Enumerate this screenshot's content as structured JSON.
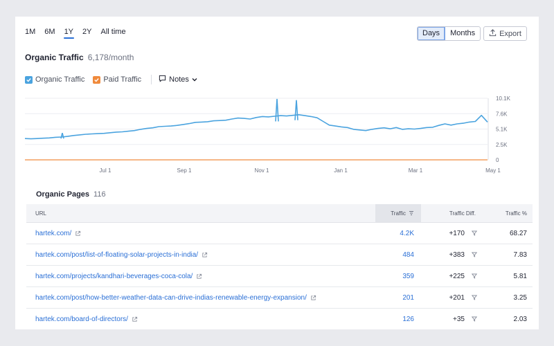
{
  "range_tabs": [
    "1M",
    "6M",
    "1Y",
    "2Y",
    "All time"
  ],
  "active_range": "1Y",
  "granularity": {
    "days": "Days",
    "months": "Months",
    "active": "Days"
  },
  "export_label": "Export",
  "title": "Organic Traffic",
  "title_value": "6,178/month",
  "legend": {
    "organic": "Organic Traffic",
    "paid": "Paid Traffic",
    "notes": "Notes",
    "organic_color": "#4aa3df",
    "paid_color": "#f08a3c"
  },
  "chart_data": {
    "type": "line",
    "x_ticks": [
      "Jul 1",
      "Sep 1",
      "Nov 1",
      "Jan 1",
      "Mar 1",
      "May 1"
    ],
    "y_ticks": [
      "10.1K",
      "7.6K",
      "5.1K",
      "2.5K",
      "0"
    ],
    "ylim": [
      0,
      10100
    ],
    "grid": true,
    "series": [
      {
        "name": "Organic Traffic",
        "values": [
          3500,
          3450,
          3500,
          3550,
          3600,
          3700,
          3750,
          3850,
          4000,
          4100,
          4200,
          4250,
          4300,
          4350,
          4450,
          4550,
          4600,
          4700,
          4800,
          5000,
          5150,
          5250,
          5450,
          5500,
          5550,
          5650,
          5800,
          5950,
          6150,
          6200,
          6250,
          6400,
          6450,
          6500,
          6700,
          6850,
          6800,
          6700,
          6950,
          7100,
          7050,
          7150,
          7250,
          7200,
          7300,
          7400,
          7250,
          7100,
          6900,
          6300,
          5700,
          5550,
          5400,
          5300,
          5000,
          4900,
          4800,
          5000,
          5150,
          5250,
          5100,
          5300,
          5000,
          5100,
          5050,
          5150,
          5300,
          5350,
          5650,
          5900,
          5700,
          5900,
          6000,
          6200,
          6300,
          7300,
          6200
        ]
      },
      {
        "name": "Paid Traffic",
        "values": [
          0,
          0,
          0,
          0,
          0,
          0,
          0,
          0,
          0,
          0,
          0,
          0,
          0,
          0,
          0,
          0,
          0,
          0,
          0,
          0,
          0,
          0,
          0,
          0,
          0,
          0,
          0,
          0,
          0,
          0,
          0,
          0,
          0,
          0,
          0,
          0,
          0,
          0,
          0,
          0,
          0,
          0,
          0,
          0,
          0,
          0,
          0,
          0,
          0,
          0,
          0,
          0,
          0,
          0,
          0,
          0,
          0,
          0,
          0,
          0,
          0,
          0,
          0,
          0,
          0,
          0,
          0,
          0,
          0,
          0,
          0,
          0,
          0,
          0,
          0,
          0,
          0
        ]
      }
    ]
  },
  "pages": {
    "title": "Organic Pages",
    "count": "116",
    "columns": {
      "url": "URL",
      "traffic": "Traffic",
      "diff": "Traffic Diff.",
      "pct": "Traffic %"
    },
    "rows": [
      {
        "url": "hartek.com/",
        "traffic": "4.2K",
        "diff": "+170",
        "pct": "68.27"
      },
      {
        "url": "hartek.com/post/list-of-floating-solar-projects-in-india/",
        "traffic": "484",
        "diff": "+383",
        "pct": "7.83"
      },
      {
        "url": "hartek.com/projects/kandhari-beverages-coca-cola/",
        "traffic": "359",
        "diff": "+225",
        "pct": "5.81"
      },
      {
        "url": "hartek.com/post/how-better-weather-data-can-drive-indias-renewable-energy-expansion/",
        "traffic": "201",
        "diff": "+201",
        "pct": "3.25"
      },
      {
        "url": "hartek.com/board-of-directors/",
        "traffic": "126",
        "diff": "+35",
        "pct": "2.03"
      }
    ]
  }
}
